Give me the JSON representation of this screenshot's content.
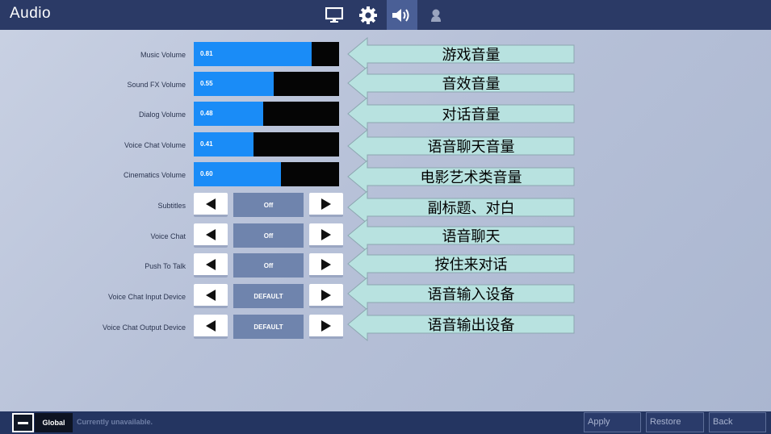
{
  "app": {
    "title": "Audio"
  },
  "tabs": [
    {
      "name": "video",
      "icon": "monitor-icon",
      "active": false
    },
    {
      "name": "game",
      "icon": "gear-icon",
      "active": false
    },
    {
      "name": "audio",
      "icon": "speaker-icon",
      "active": true
    },
    {
      "name": "account",
      "icon": "user-icon",
      "active": false
    }
  ],
  "settings": {
    "music_volume": {
      "label": "Music Volume",
      "value": "0.81",
      "level": 0.81
    },
    "sound_fx_volume": {
      "label": "Sound FX Volume",
      "value": "0.55",
      "level": 0.55
    },
    "dialog_volume": {
      "label": "Dialog Volume",
      "value": "0.48",
      "level": 0.48
    },
    "voice_chat_volume": {
      "label": "Voice Chat Volume",
      "value": "0.41",
      "level": 0.41
    },
    "cinematics_volume": {
      "label": "Cinematics Volume",
      "value": "0.60",
      "level": 0.6
    },
    "subtitles": {
      "label": "Subtitles",
      "value": "Off"
    },
    "voice_chat": {
      "label": "Voice Chat",
      "value": "Off"
    },
    "push_to_talk": {
      "label": "Push To Talk",
      "value": "Off"
    },
    "voice_chat_input_device": {
      "label": "Voice Chat Input Device",
      "value": "DEFAULT"
    },
    "voice_chat_output_device": {
      "label": "Voice Chat Output Device",
      "value": "DEFAULT"
    }
  },
  "annotations": [
    "游戏音量",
    "音效音量",
    "对话音量",
    "语音聊天音量",
    "电影艺术类音量",
    "副标题、对白",
    "语音聊天",
    "按住来对话",
    "语音输入设备",
    "语音输出设备"
  ],
  "colors": {
    "slider_fill": "#1a8cf7",
    "slider_track": "#050505",
    "callout_fill": "#b8e2e0",
    "header_bg": "#2b3a66"
  },
  "footer": {
    "global_label": "Global",
    "status": "Currently unavailable.",
    "apply_label": "Apply",
    "restore_label": "Restore",
    "back_label": "Back"
  }
}
